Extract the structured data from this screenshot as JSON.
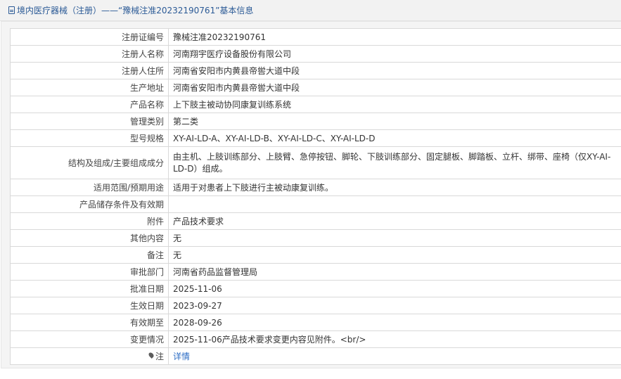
{
  "header": {
    "title": "境内医疗器械（注册）——“豫械注准20232190761”基本信息",
    "icon": "document-icon"
  },
  "rows": [
    {
      "label": "注册证编号",
      "value": "豫械注准20232190761"
    },
    {
      "label": "注册人名称",
      "value": "河南翔宇医疗设备股份有限公司"
    },
    {
      "label": "注册人住所",
      "value": "河南省安阳市内黄县帝喾大道中段"
    },
    {
      "label": "生产地址",
      "value": "河南省安阳市内黄县帝喾大道中段"
    },
    {
      "label": "产品名称",
      "value": "上下肢主被动协同康复训练系统"
    },
    {
      "label": "管理类别",
      "value": "第二类"
    },
    {
      "label": "型号规格",
      "value": "XY-AI-LD-A、XY-AI-LD-B、XY-AI-LD-C、XY-AI-LD-D"
    },
    {
      "label": "结构及组成/主要组成成分",
      "value": "由主机、上肢训练部分、上肢臂、急停按钮、脚轮、下肢训练部分、固定腿板、脚踏板、立杆、绑带、座椅（仅XY-AI-LD-D）组成。"
    },
    {
      "label": "适用范围/预期用途",
      "value": "适用于对患者上下肢进行主被动康复训练。"
    },
    {
      "label": "产品储存条件及有效期",
      "value": ""
    },
    {
      "label": "附件",
      "value": "产品技术要求"
    },
    {
      "label": "其他内容",
      "value": "无"
    },
    {
      "label": "备注",
      "value": "无"
    },
    {
      "label": "审批部门",
      "value": "河南省药品监督管理局"
    },
    {
      "label": "批准日期",
      "value": "2025-11-06"
    },
    {
      "label": "生效日期",
      "value": "2023-09-27"
    },
    {
      "label": "有效期至",
      "value": "2028-09-26"
    },
    {
      "label": "变更情况",
      "value": "2025-11-06产品技术要求变更内容见附件。<br/>"
    }
  ],
  "note_row": {
    "label": "注",
    "icon": "pin-icon",
    "link_text": "详情"
  },
  "colors": {
    "header_text": "#2b5a96",
    "link": "#2b6cc4",
    "border": "#d9d9d9"
  }
}
